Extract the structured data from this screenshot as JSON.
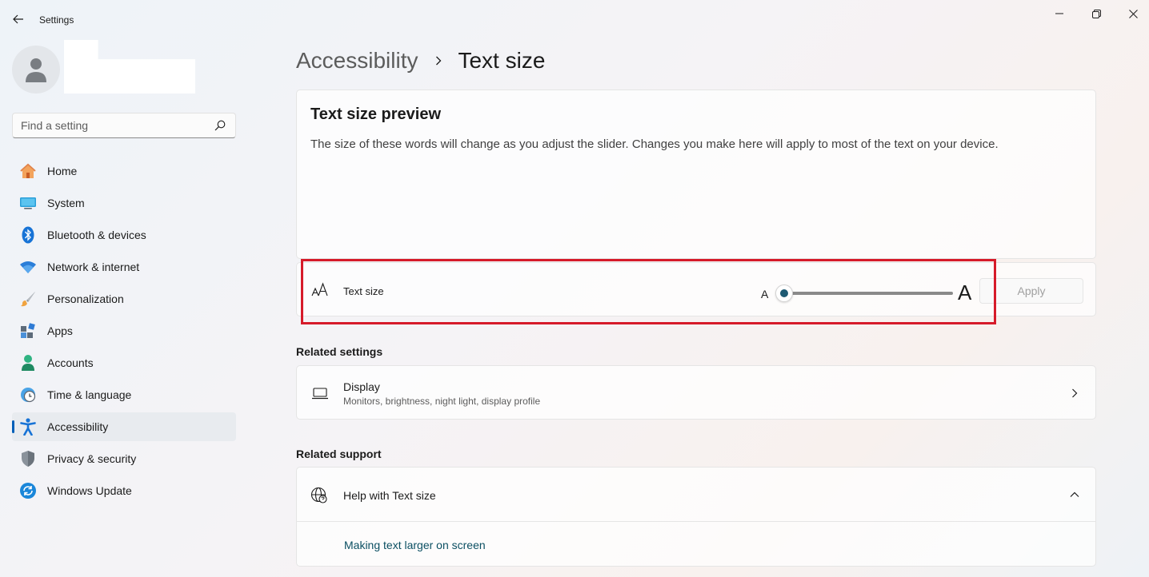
{
  "window": {
    "title": "Settings"
  },
  "sidebar": {
    "search_placeholder": "Find a setting",
    "items": [
      {
        "label": "Home",
        "icon": "home-icon"
      },
      {
        "label": "System",
        "icon": "system-icon"
      },
      {
        "label": "Bluetooth & devices",
        "icon": "bluetooth-icon"
      },
      {
        "label": "Network & internet",
        "icon": "wifi-icon"
      },
      {
        "label": "Personalization",
        "icon": "brush-icon"
      },
      {
        "label": "Apps",
        "icon": "apps-icon"
      },
      {
        "label": "Accounts",
        "icon": "accounts-icon"
      },
      {
        "label": "Time & language",
        "icon": "clock-globe-icon"
      },
      {
        "label": "Accessibility",
        "icon": "accessibility-icon",
        "active": true
      },
      {
        "label": "Privacy & security",
        "icon": "shield-icon"
      },
      {
        "label": "Windows Update",
        "icon": "update-icon"
      }
    ]
  },
  "breadcrumb": {
    "parent": "Accessibility",
    "current": "Text size"
  },
  "preview": {
    "title": "Text size preview",
    "description": "The size of these words will change as you adjust the slider. Changes you make here will apply to most of the text on your device."
  },
  "text_size": {
    "label": "Text size",
    "small_a": "A",
    "large_a": "A",
    "slider_value_fraction": 0,
    "apply_label": "Apply"
  },
  "related_settings": {
    "title": "Related settings",
    "display": {
      "title": "Display",
      "subtitle": "Monitors, brightness, night light, display profile"
    }
  },
  "related_support": {
    "title": "Related support",
    "help_title": "Help with Text size",
    "link": "Making text larger on screen"
  },
  "colors": {
    "accent": "#005fb8",
    "slider_thumb": "#1e5a73",
    "highlight": "#d61b2a",
    "link": "#0b4f62"
  }
}
